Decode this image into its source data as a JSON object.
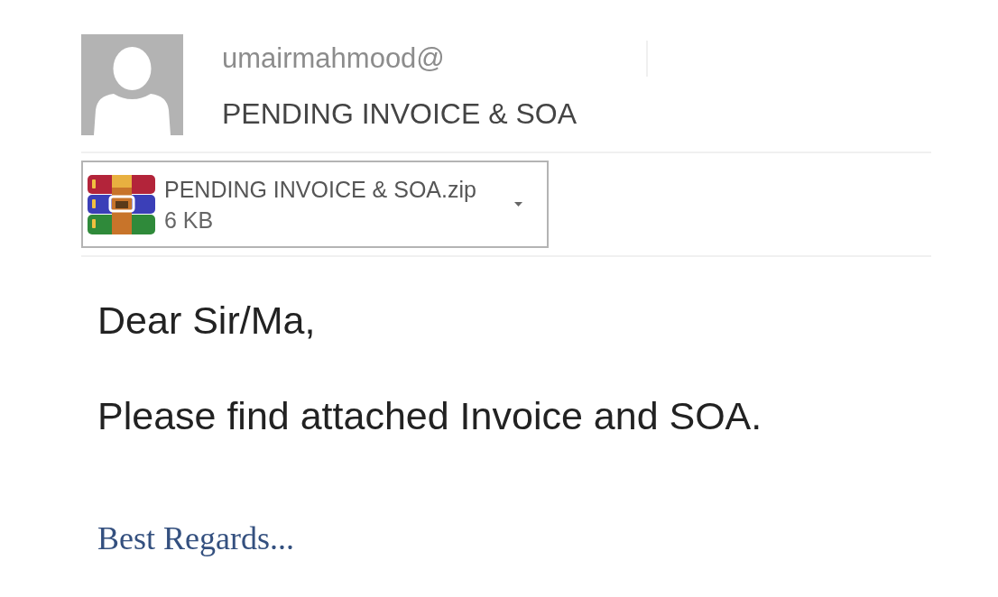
{
  "message": {
    "sender": "umairmahmood@",
    "subject": "PENDING INVOICE & SOA"
  },
  "attachments": [
    {
      "name": "PENDING INVOICE & SOA.zip",
      "size": "6 KB"
    }
  ],
  "body": {
    "paragraphs": [
      "Dear Sir/Ma,",
      "Please find attached Invoice and SOA."
    ],
    "signature": "Best Regards..."
  }
}
